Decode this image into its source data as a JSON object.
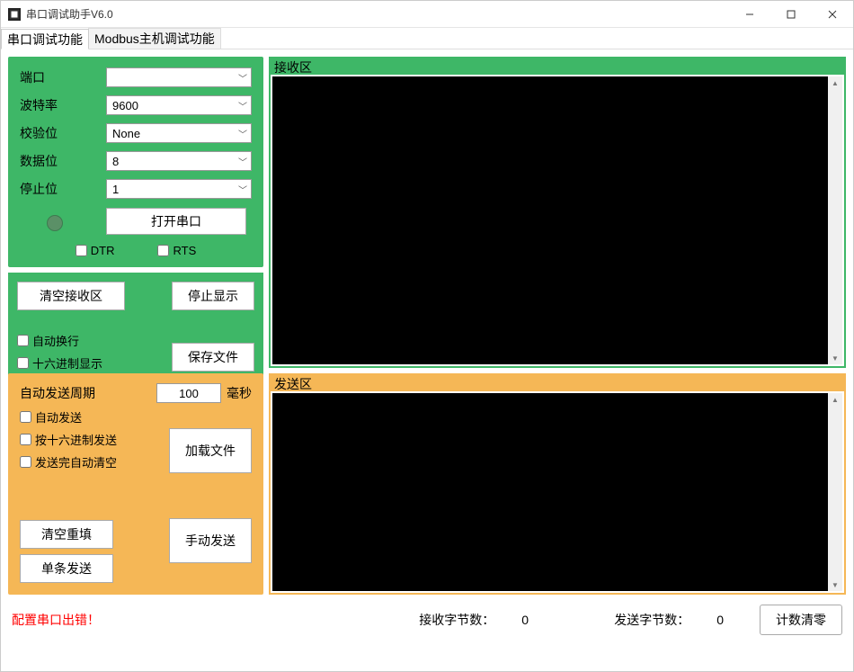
{
  "window": {
    "title": "串口调试助手V6.0"
  },
  "tabs": {
    "active": "串口调试功能",
    "inactive": "Modbus主机调试功能"
  },
  "serial_config": {
    "port_label": "端口",
    "port_value": "",
    "baud_label": "波特率",
    "baud_value": "9600",
    "parity_label": "校验位",
    "parity_value": "None",
    "data_label": "数据位",
    "data_value": "8",
    "stop_label": "停止位",
    "stop_value": "1",
    "open_button": "打开串口",
    "dtr_label": "DTR",
    "rts_label": "RTS"
  },
  "rx_panel": {
    "title": "接收区"
  },
  "rx_controls": {
    "clear_button": "清空接收区",
    "pause_button": "停止显示",
    "save_button": "保存文件",
    "auto_wrap": "自动换行",
    "hex_display": "十六进制显示"
  },
  "tx_controls": {
    "period_label": "自动发送周期",
    "period_value": "100",
    "period_unit": "毫秒",
    "auto_send": "自动发送",
    "hex_send": "按十六进制发送",
    "auto_clear": "发送完自动清空",
    "load_button": "加载文件",
    "clear_refill_button": "清空重填",
    "single_send_button": "单条发送",
    "manual_send_button": "手动发送"
  },
  "tx_panel": {
    "title": "发送区"
  },
  "footer": {
    "error": "配置串口出错！",
    "rx_label": "接收字节数：",
    "rx_value": "0",
    "tx_label": "发送字节数：",
    "tx_value": "0",
    "reset_button": "计数清零"
  }
}
